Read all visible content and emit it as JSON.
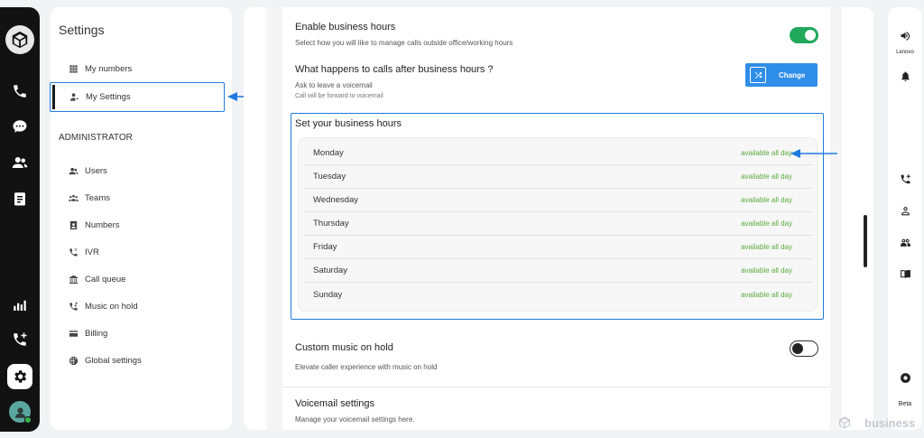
{
  "rail": {
    "icons": [
      "app-logo-icon",
      "phone-icon",
      "chat-icon",
      "contacts-icon",
      "notes-icon",
      "analytics-icon",
      "add-call-icon",
      "gear-icon",
      "user-avatar"
    ]
  },
  "sidebar": {
    "title": "Settings",
    "items": [
      {
        "label": "My numbers",
        "icon": "grid-icon"
      },
      {
        "label": "My Settings",
        "icon": "person-icon"
      }
    ],
    "admin_heading": "ADMINISTRATOR",
    "admin_items": [
      {
        "label": "Users",
        "icon": "users-icon"
      },
      {
        "label": "Teams",
        "icon": "teams-icon"
      },
      {
        "label": "Numbers",
        "icon": "numbers-icon"
      },
      {
        "label": "IVR",
        "icon": "ivr-icon"
      },
      {
        "label": "Call queue",
        "icon": "call-queue-icon"
      },
      {
        "label": "Music on hold",
        "icon": "music-hold-icon"
      },
      {
        "label": "Billing",
        "icon": "billing-icon"
      },
      {
        "label": "Global settings",
        "icon": "globe-icon"
      }
    ]
  },
  "main": {
    "business_hours": {
      "title": "Enable business hours",
      "desc": "Select how you will like to manage calls outside office/working hours",
      "enabled": true
    },
    "after_hours": {
      "title": "What happens to calls after business hours ?",
      "option": "Ask to leave a voicemail",
      "note": "Call will be forward to voicemail",
      "change_label": "Change"
    },
    "set_hours": {
      "title": "Set your business hours",
      "days": [
        {
          "day": "Monday",
          "status": "available all day"
        },
        {
          "day": "Tuesday",
          "status": "available all day"
        },
        {
          "day": "Wednesday",
          "status": "available all day"
        },
        {
          "day": "Thursday",
          "status": "available all day"
        },
        {
          "day": "Friday",
          "status": "available all day"
        },
        {
          "day": "Saturday",
          "status": "available all day"
        },
        {
          "day": "Sunday",
          "status": "available all day"
        }
      ]
    },
    "music_hold": {
      "title": "Custom music on hold",
      "desc": "Elevate caller experience with music on hold",
      "enabled": false
    },
    "voicemail": {
      "title": "Voicemail settings",
      "desc": "Manage your voicemail settings here."
    }
  },
  "right_panel": {
    "lenovo_label": "Lenovo",
    "beta_label": "Beta"
  },
  "brand": {
    "name": "business"
  },
  "colors": {
    "accent": "#1f7ae0",
    "toggle_on": "#1fa85a",
    "status_green": "#5bab3e",
    "change_button": "#2f8ee8",
    "rail": "#121212"
  }
}
